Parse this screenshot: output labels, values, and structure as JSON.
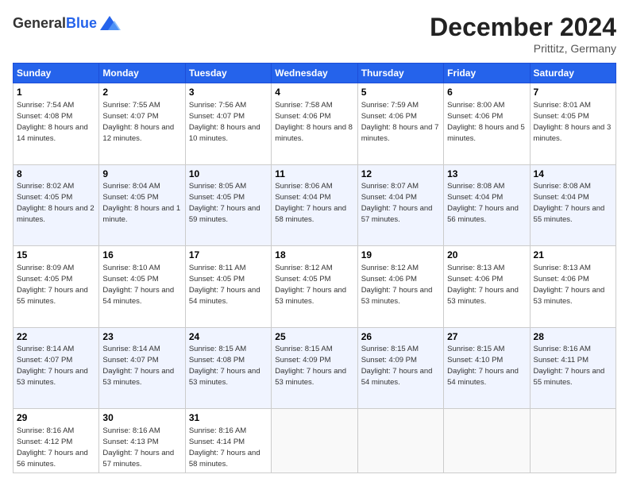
{
  "header": {
    "logo_line1": "General",
    "logo_line2": "Blue",
    "month": "December 2024",
    "location": "Prittitz, Germany"
  },
  "weekdays": [
    "Sunday",
    "Monday",
    "Tuesday",
    "Wednesday",
    "Thursday",
    "Friday",
    "Saturday"
  ],
  "weeks": [
    [
      {
        "day": "1",
        "sunrise": "7:54 AM",
        "sunset": "4:08 PM",
        "daylight": "8 hours and 14 minutes."
      },
      {
        "day": "2",
        "sunrise": "7:55 AM",
        "sunset": "4:07 PM",
        "daylight": "8 hours and 12 minutes."
      },
      {
        "day": "3",
        "sunrise": "7:56 AM",
        "sunset": "4:07 PM",
        "daylight": "8 hours and 10 minutes."
      },
      {
        "day": "4",
        "sunrise": "7:58 AM",
        "sunset": "4:06 PM",
        "daylight": "8 hours and 8 minutes."
      },
      {
        "day": "5",
        "sunrise": "7:59 AM",
        "sunset": "4:06 PM",
        "daylight": "8 hours and 7 minutes."
      },
      {
        "day": "6",
        "sunrise": "8:00 AM",
        "sunset": "4:06 PM",
        "daylight": "8 hours and 5 minutes."
      },
      {
        "day": "7",
        "sunrise": "8:01 AM",
        "sunset": "4:05 PM",
        "daylight": "8 hours and 3 minutes."
      }
    ],
    [
      {
        "day": "8",
        "sunrise": "8:02 AM",
        "sunset": "4:05 PM",
        "daylight": "8 hours and 2 minutes."
      },
      {
        "day": "9",
        "sunrise": "8:04 AM",
        "sunset": "4:05 PM",
        "daylight": "8 hours and 1 minute."
      },
      {
        "day": "10",
        "sunrise": "8:05 AM",
        "sunset": "4:05 PM",
        "daylight": "7 hours and 59 minutes."
      },
      {
        "day": "11",
        "sunrise": "8:06 AM",
        "sunset": "4:04 PM",
        "daylight": "7 hours and 58 minutes."
      },
      {
        "day": "12",
        "sunrise": "8:07 AM",
        "sunset": "4:04 PM",
        "daylight": "7 hours and 57 minutes."
      },
      {
        "day": "13",
        "sunrise": "8:08 AM",
        "sunset": "4:04 PM",
        "daylight": "7 hours and 56 minutes."
      },
      {
        "day": "14",
        "sunrise": "8:08 AM",
        "sunset": "4:04 PM",
        "daylight": "7 hours and 55 minutes."
      }
    ],
    [
      {
        "day": "15",
        "sunrise": "8:09 AM",
        "sunset": "4:05 PM",
        "daylight": "7 hours and 55 minutes."
      },
      {
        "day": "16",
        "sunrise": "8:10 AM",
        "sunset": "4:05 PM",
        "daylight": "7 hours and 54 minutes."
      },
      {
        "day": "17",
        "sunrise": "8:11 AM",
        "sunset": "4:05 PM",
        "daylight": "7 hours and 54 minutes."
      },
      {
        "day": "18",
        "sunrise": "8:12 AM",
        "sunset": "4:05 PM",
        "daylight": "7 hours and 53 minutes."
      },
      {
        "day": "19",
        "sunrise": "8:12 AM",
        "sunset": "4:06 PM",
        "daylight": "7 hours and 53 minutes."
      },
      {
        "day": "20",
        "sunrise": "8:13 AM",
        "sunset": "4:06 PM",
        "daylight": "7 hours and 53 minutes."
      },
      {
        "day": "21",
        "sunrise": "8:13 AM",
        "sunset": "4:06 PM",
        "daylight": "7 hours and 53 minutes."
      }
    ],
    [
      {
        "day": "22",
        "sunrise": "8:14 AM",
        "sunset": "4:07 PM",
        "daylight": "7 hours and 53 minutes."
      },
      {
        "day": "23",
        "sunrise": "8:14 AM",
        "sunset": "4:07 PM",
        "daylight": "7 hours and 53 minutes."
      },
      {
        "day": "24",
        "sunrise": "8:15 AM",
        "sunset": "4:08 PM",
        "daylight": "7 hours and 53 minutes."
      },
      {
        "day": "25",
        "sunrise": "8:15 AM",
        "sunset": "4:09 PM",
        "daylight": "7 hours and 53 minutes."
      },
      {
        "day": "26",
        "sunrise": "8:15 AM",
        "sunset": "4:09 PM",
        "daylight": "7 hours and 54 minutes."
      },
      {
        "day": "27",
        "sunrise": "8:15 AM",
        "sunset": "4:10 PM",
        "daylight": "7 hours and 54 minutes."
      },
      {
        "day": "28",
        "sunrise": "8:16 AM",
        "sunset": "4:11 PM",
        "daylight": "7 hours and 55 minutes."
      }
    ],
    [
      {
        "day": "29",
        "sunrise": "8:16 AM",
        "sunset": "4:12 PM",
        "daylight": "7 hours and 56 minutes."
      },
      {
        "day": "30",
        "sunrise": "8:16 AM",
        "sunset": "4:13 PM",
        "daylight": "7 hours and 57 minutes."
      },
      {
        "day": "31",
        "sunrise": "8:16 AM",
        "sunset": "4:14 PM",
        "daylight": "7 hours and 58 minutes."
      },
      null,
      null,
      null,
      null
    ]
  ]
}
